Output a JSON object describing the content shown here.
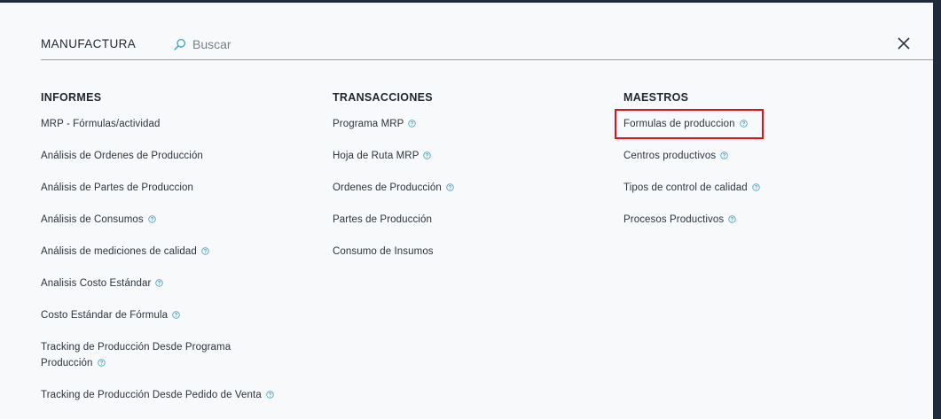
{
  "header": {
    "module_title": "MANUFACTURA",
    "search_placeholder": "Buscar",
    "search_value": ""
  },
  "icons": {
    "search": "search-icon",
    "close": "close-icon",
    "help": "help-circle-icon"
  },
  "colors": {
    "accent": "#5bb5cf",
    "highlight": "#e3101a",
    "text": "#2b3440"
  },
  "columns": [
    {
      "title": "INFORMES",
      "items": [
        {
          "label": "MRP - Fórmulas/actividad",
          "help": false
        },
        {
          "label": "Análisis de Ordenes de Producción",
          "help": false
        },
        {
          "label": "Análisis de Partes de Produccion",
          "help": false
        },
        {
          "label": "Análisis de Consumos",
          "help": true
        },
        {
          "label": "Análisis de mediciones de calidad",
          "help": true
        },
        {
          "label": "Analisis Costo Estándar",
          "help": true
        },
        {
          "label": "Costo Estándar de Fórmula",
          "help": true
        },
        {
          "label": "Tracking de Producción Desde Programa Producción",
          "help": true
        },
        {
          "label": "Tracking de Producción Desde Pedido de Venta",
          "help": true
        }
      ]
    },
    {
      "title": "TRANSACCIONES",
      "items": [
        {
          "label": "Programa MRP",
          "help": true
        },
        {
          "label": "Hoja de Ruta MRP",
          "help": true
        },
        {
          "label": "Ordenes de Producción",
          "help": true
        },
        {
          "label": "Partes de Producción",
          "help": false
        },
        {
          "label": "Consumo de Insumos",
          "help": false
        }
      ]
    },
    {
      "title": "MAESTROS",
      "items": [
        {
          "label": "Formulas de produccion",
          "help": true,
          "highlighted": true
        },
        {
          "label": "Centros productivos",
          "help": true
        },
        {
          "label": "Tipos de control de calidad",
          "help": true
        },
        {
          "label": "Procesos Productivos",
          "help": true
        }
      ]
    }
  ]
}
